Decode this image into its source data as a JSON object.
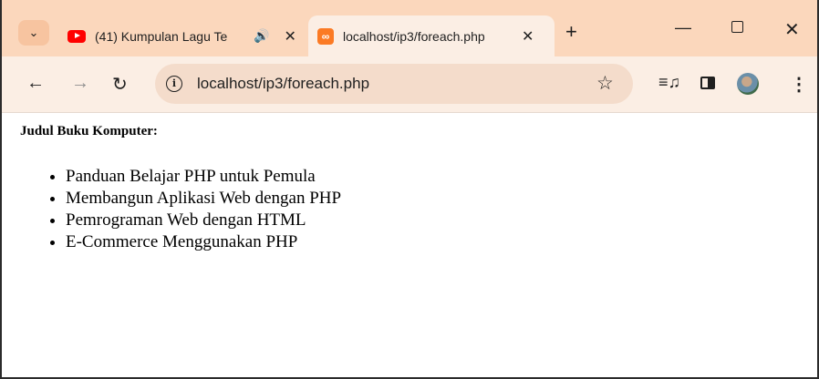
{
  "browser": {
    "tabs": [
      {
        "title": "(41) Kumpulan Lagu Te",
        "icon": "youtube-icon",
        "audio": true
      },
      {
        "title": "localhost/ip3/foreach.php",
        "icon": "xampp-icon",
        "active": true
      }
    ],
    "tab_close_glyph": "✕",
    "new_tab_glyph": "+",
    "address": "localhost/ip3/foreach.php",
    "accent_color": "#fbd7bc"
  },
  "page": {
    "heading": "Judul Buku Komputer:",
    "books": [
      "Panduan Belajar PHP untuk Pemula",
      "Membangun Aplikasi Web dengan PHP",
      "Pemrograman Web dengan HTML",
      "E-Commerce Menggunakan PHP"
    ]
  }
}
